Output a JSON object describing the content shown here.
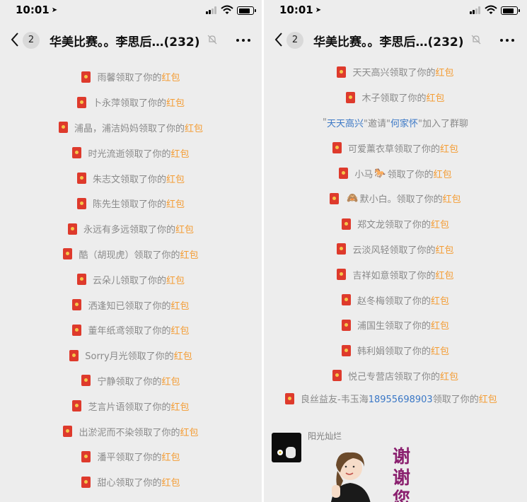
{
  "status_bar": {
    "time": "10:01"
  },
  "chat": {
    "back_badge": "2",
    "title": "华美比赛。。李思后…(232)"
  },
  "red_packet_label": "红包",
  "left_panel": {
    "notices": [
      {
        "prefix": "",
        "name": "雨馨",
        "verb": "领取了你的"
      },
      {
        "prefix": "",
        "name": "卜永萍",
        "verb": "领取了你的"
      },
      {
        "prefix": "",
        "name": "浦晶，浦洁妈妈",
        "verb": "领取了你的"
      },
      {
        "prefix": "",
        "name": "时光流逝",
        "verb": "领取了你的"
      },
      {
        "prefix": "",
        "name": "朱志文",
        "verb": "领取了你的"
      },
      {
        "prefix": "",
        "name": "陈先生",
        "verb": "领取了你的"
      },
      {
        "prefix": "",
        "name": "永远有多远",
        "verb": "领取了你的"
      },
      {
        "prefix": "",
        "name": "酷（胡现虎）",
        "verb": "领取了你的"
      },
      {
        "prefix": "",
        "name": "云朵儿",
        "verb": "领取了你的"
      },
      {
        "prefix": "",
        "name": "洒逢知已",
        "verb": "领取了你的"
      },
      {
        "prefix": "",
        "name": "董年纸鸢",
        "verb": "领取了你的"
      },
      {
        "prefix": "",
        "name": "Sorry月光",
        "verb": "领取了你的"
      },
      {
        "prefix": "",
        "name": "宁静",
        "verb": "领取了你的"
      },
      {
        "prefix": "",
        "name": "芝言片语",
        "verb": "领取了你的"
      },
      {
        "prefix": "",
        "name": "出淤泥而不染",
        "verb": "领取了你的"
      },
      {
        "prefix": "",
        "name": "潘平",
        "verb": "领取了你的"
      },
      {
        "prefix": "",
        "name": "甜心",
        "verb": "领取了你的"
      }
    ]
  },
  "right_panel": {
    "notices_top": [
      {
        "name": "天天高兴",
        "verb": "领取了你的"
      },
      {
        "name": "木子",
        "verb": "领取了你的"
      }
    ],
    "join_notice": {
      "quote_open": "\"",
      "inviter": "天天高兴",
      "mid": "\"邀请\"",
      "invitee": "何家怀",
      "tail": "\"加入了群聊"
    },
    "notices_bottom": [
      {
        "name": "可爱薰衣草",
        "emoji": "",
        "verb": "领取了你的"
      },
      {
        "name": "小马",
        "emoji": "🐎",
        "verb": "领取了你的"
      },
      {
        "name": "默小白。",
        "emoji": "🙈",
        "emoji_first": true,
        "verb": "领取了你的"
      },
      {
        "name": "郑文龙",
        "emoji": "",
        "verb": "领取了你的"
      },
      {
        "name": "云淡风轻",
        "emoji": "",
        "verb": "领取了你的"
      },
      {
        "name": "吉祥如意",
        "emoji": "",
        "verb": "领取了你的"
      },
      {
        "name": "赵冬梅",
        "emoji": "",
        "verb": "领取了你的"
      },
      {
        "name": "浦国生",
        "emoji": "",
        "verb": "领取了你的"
      },
      {
        "name": "韩利娟",
        "emoji": "",
        "verb": "领取了你的"
      },
      {
        "name": "悦己专营店",
        "emoji": "",
        "verb": "领取了你的"
      }
    ],
    "long_notice": {
      "name": "良丝益友-韦玉海",
      "phone": "18955698903",
      "verb": "领取了你的"
    },
    "message": {
      "sender": "阳光灿烂",
      "sticker_text": [
        "谢",
        "谢",
        "您"
      ]
    }
  }
}
